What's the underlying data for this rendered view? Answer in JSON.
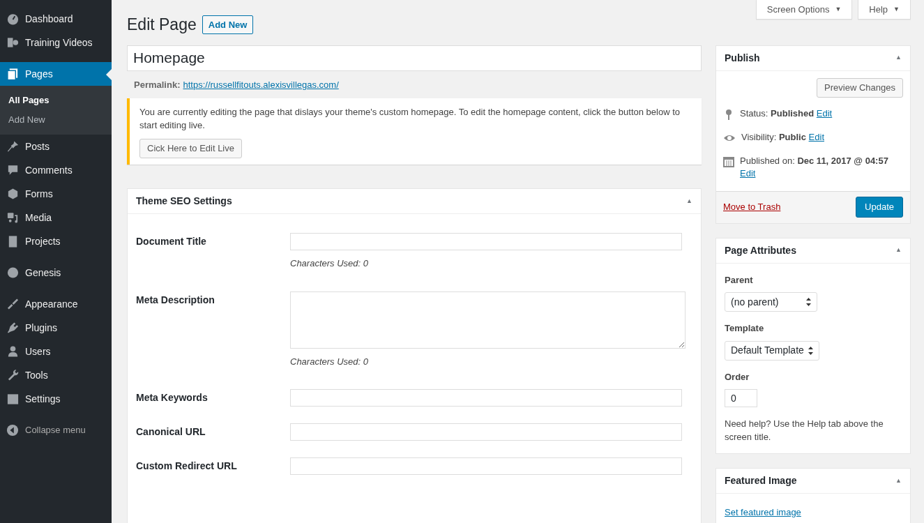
{
  "sidebar": {
    "items": [
      {
        "label": "Dashboard",
        "selected": false
      },
      {
        "label": "Training Videos",
        "selected": false
      },
      {
        "label": "Pages",
        "selected": true,
        "children": [
          {
            "label": "All Pages",
            "selected": true
          },
          {
            "label": "Add New",
            "selected": false
          }
        ]
      },
      {
        "label": "Posts",
        "selected": false
      },
      {
        "label": "Comments",
        "selected": false
      },
      {
        "label": "Forms",
        "selected": false
      },
      {
        "label": "Media",
        "selected": false
      },
      {
        "label": "Projects",
        "selected": false
      },
      {
        "label": "Genesis",
        "selected": false
      },
      {
        "label": "Appearance",
        "selected": false
      },
      {
        "label": "Plugins",
        "selected": false
      },
      {
        "label": "Users",
        "selected": false
      },
      {
        "label": "Tools",
        "selected": false
      },
      {
        "label": "Settings",
        "selected": false
      }
    ],
    "collapse": "Collapse menu"
  },
  "top_tabs": [
    {
      "label": "Screen Options",
      "caret": "▼"
    },
    {
      "label": "Help",
      "caret": "▼"
    }
  ],
  "heading": {
    "title": "Edit Page",
    "add_new": "Add New"
  },
  "post_title": "Homepage",
  "permalink": {
    "label": "Permalink:",
    "url": "https://russellfitouts.alexisvillegas.com/"
  },
  "notice": {
    "text": "You are currently editing the page that dislays your theme's custom homepage. To edit the homepage content, click the button below to start editing live.",
    "button": "Cick Here to Edit Live"
  },
  "seo_box": {
    "title": "Theme SEO Settings",
    "toggle": "▲",
    "fields": [
      {
        "label": "Document Title",
        "kind": "input",
        "note": "Characters Used: 0"
      },
      {
        "label": "Meta Description",
        "kind": "textarea",
        "note": "Characters Used: 0"
      },
      {
        "label": "Meta Keywords",
        "kind": "input"
      },
      {
        "label": "Canonical URL",
        "kind": "input"
      },
      {
        "label": "Custom Redirect URL",
        "kind": "input"
      }
    ]
  },
  "publish": {
    "title": "Publish",
    "toggle": "▲",
    "preview": "Preview Changes",
    "rows": [
      {
        "text": "Status: **Published**",
        "link": "Edit"
      },
      {
        "text": "Visibility: **Public**",
        "link": "Edit"
      },
      {
        "text": "Published on: **Dec 11, 2017 @ 04:57**",
        "link": "Edit"
      }
    ],
    "trash": "Move to Trash",
    "update": "Update"
  },
  "page_attributes": {
    "title": "Page Attributes",
    "toggle": "▲",
    "parent_label": "Parent",
    "parent_value": "(no parent)",
    "template_label": "Template",
    "template_value": "Default Template",
    "order_label": "Order",
    "order_value": "0",
    "help": "Need help? Use the Help tab above the screen title."
  },
  "featured_image": {
    "title": "Featured Image",
    "toggle": "▲",
    "link": "Set featured image"
  }
}
